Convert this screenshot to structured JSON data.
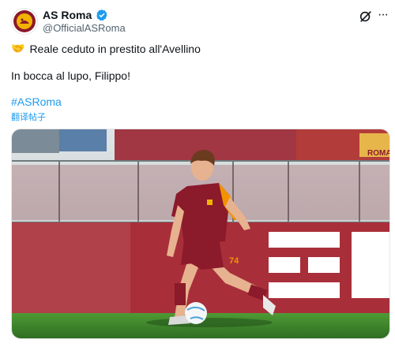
{
  "account": {
    "name": "AS Roma",
    "handle": "@OfficialASRoma",
    "avatar_icon": "as-roma-crest",
    "verified_icon": "verified-badge"
  },
  "actions": {
    "grok_icon": "grok-icon",
    "more_icon": "more-icon"
  },
  "tweet": {
    "emoji": "🤝",
    "line1": "Reale ceduto in prestito all'Avellino",
    "line2": "In bocca al lupo, Filippo!",
    "hashtag": "#ASRoma",
    "translate": "翻译帖子"
  },
  "photo": {
    "jersey_number": "74",
    "banner_text": "ROMA",
    "colors": {
      "jersey": "#8b1a2b",
      "accent": "#f39200",
      "grass": "#3f8a2c",
      "wall": "#a3303a"
    }
  },
  "colors": {
    "link": "#1d9bf0",
    "secondary": "#536471",
    "verified": "#1d9bf0"
  }
}
